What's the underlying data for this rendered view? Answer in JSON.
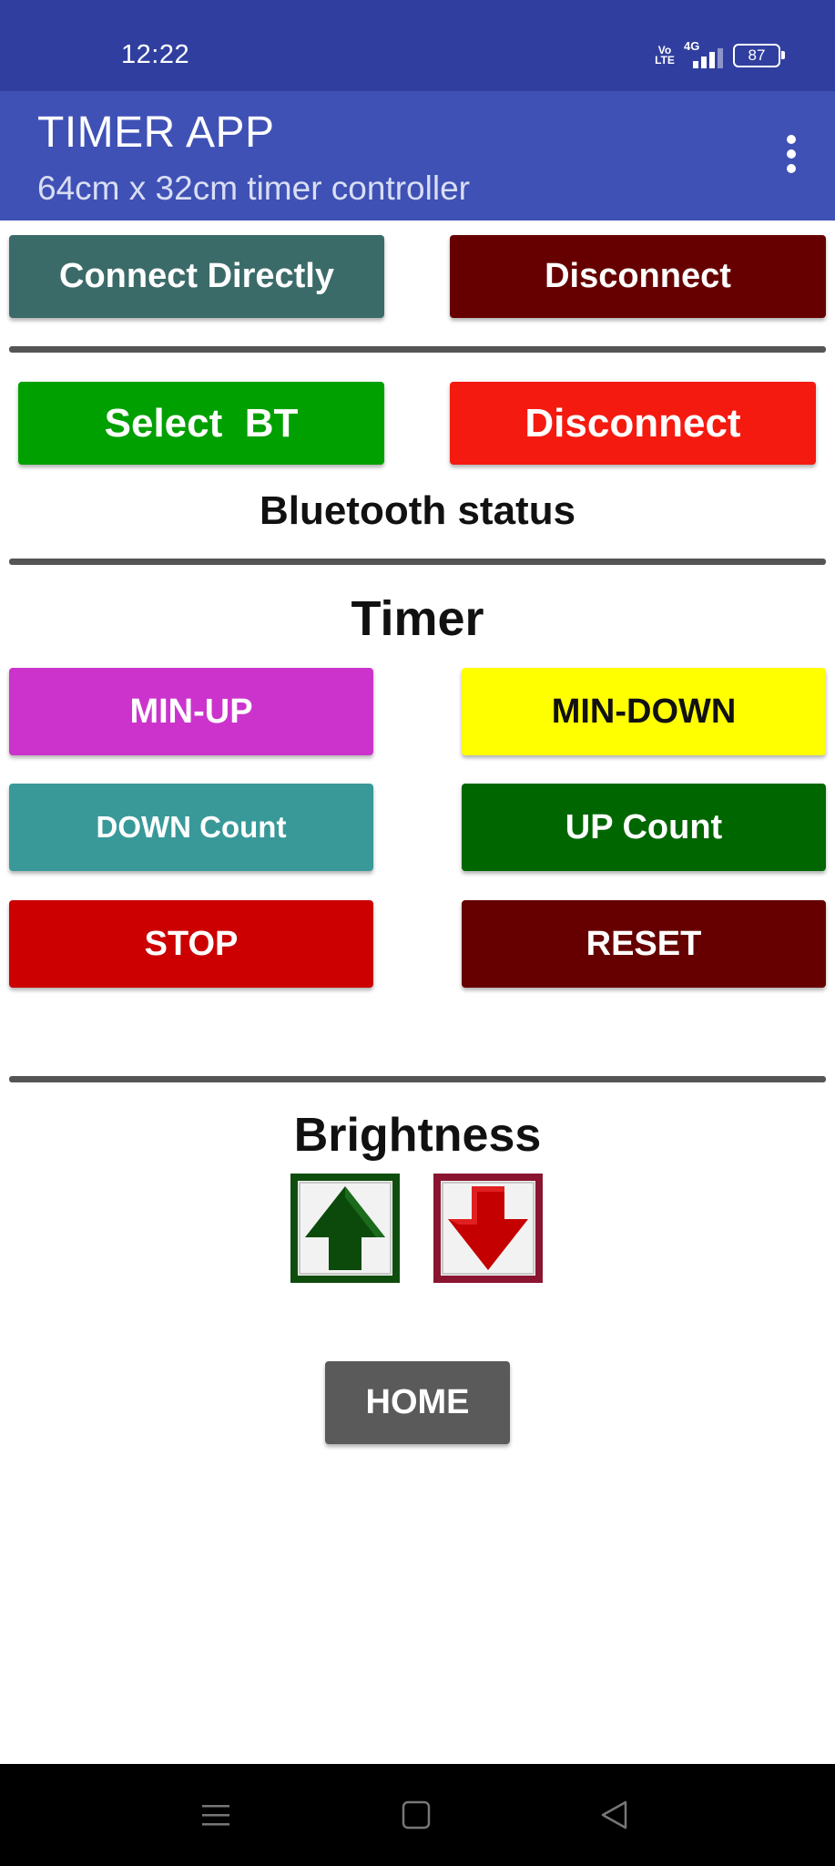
{
  "status_bar": {
    "time": "12:22",
    "volte": "Vo\nLTE",
    "network": "4G",
    "battery": "87"
  },
  "app_bar": {
    "title": "TIMER APP",
    "subtitle": "64cm x 32cm timer controller",
    "menu_icon": "kebab-menu-icon"
  },
  "wifi_section": {
    "connect_label": "Connect Directly",
    "disconnect_label": "Disconnect"
  },
  "bt_section": {
    "select_label": "Select  BT",
    "disconnect_label": "Disconnect",
    "status_text": "Bluetooth status"
  },
  "timer_section": {
    "heading": "Timer",
    "min_up_label": "MIN-UP",
    "min_down_label": "MIN-DOWN",
    "down_count_label": "DOWN Count",
    "up_count_label": "UP Count",
    "stop_label": "STOP",
    "reset_label": "RESET"
  },
  "brightness_section": {
    "heading": "Brightness",
    "up_icon": "arrow-up-icon",
    "down_icon": "arrow-down-icon"
  },
  "home_label": "HOME",
  "nav_bar": {
    "menu_icon": "recents-icon",
    "home_icon": "home-square-icon",
    "back_icon": "back-triangle-icon"
  },
  "colors": {
    "status_bar": "#303f9f",
    "app_bar": "#3f51b5",
    "connect": "#3b6b69",
    "disconnect_dark": "#660000",
    "select_bt": "#00a000",
    "disconnect_red": "#f51a10",
    "min_up": "#cc33cc",
    "min_down": "#ffff00",
    "down_count": "#399999",
    "up_count": "#006600",
    "stop": "#cc0000",
    "reset": "#660000",
    "home": "#5a5a5a"
  }
}
